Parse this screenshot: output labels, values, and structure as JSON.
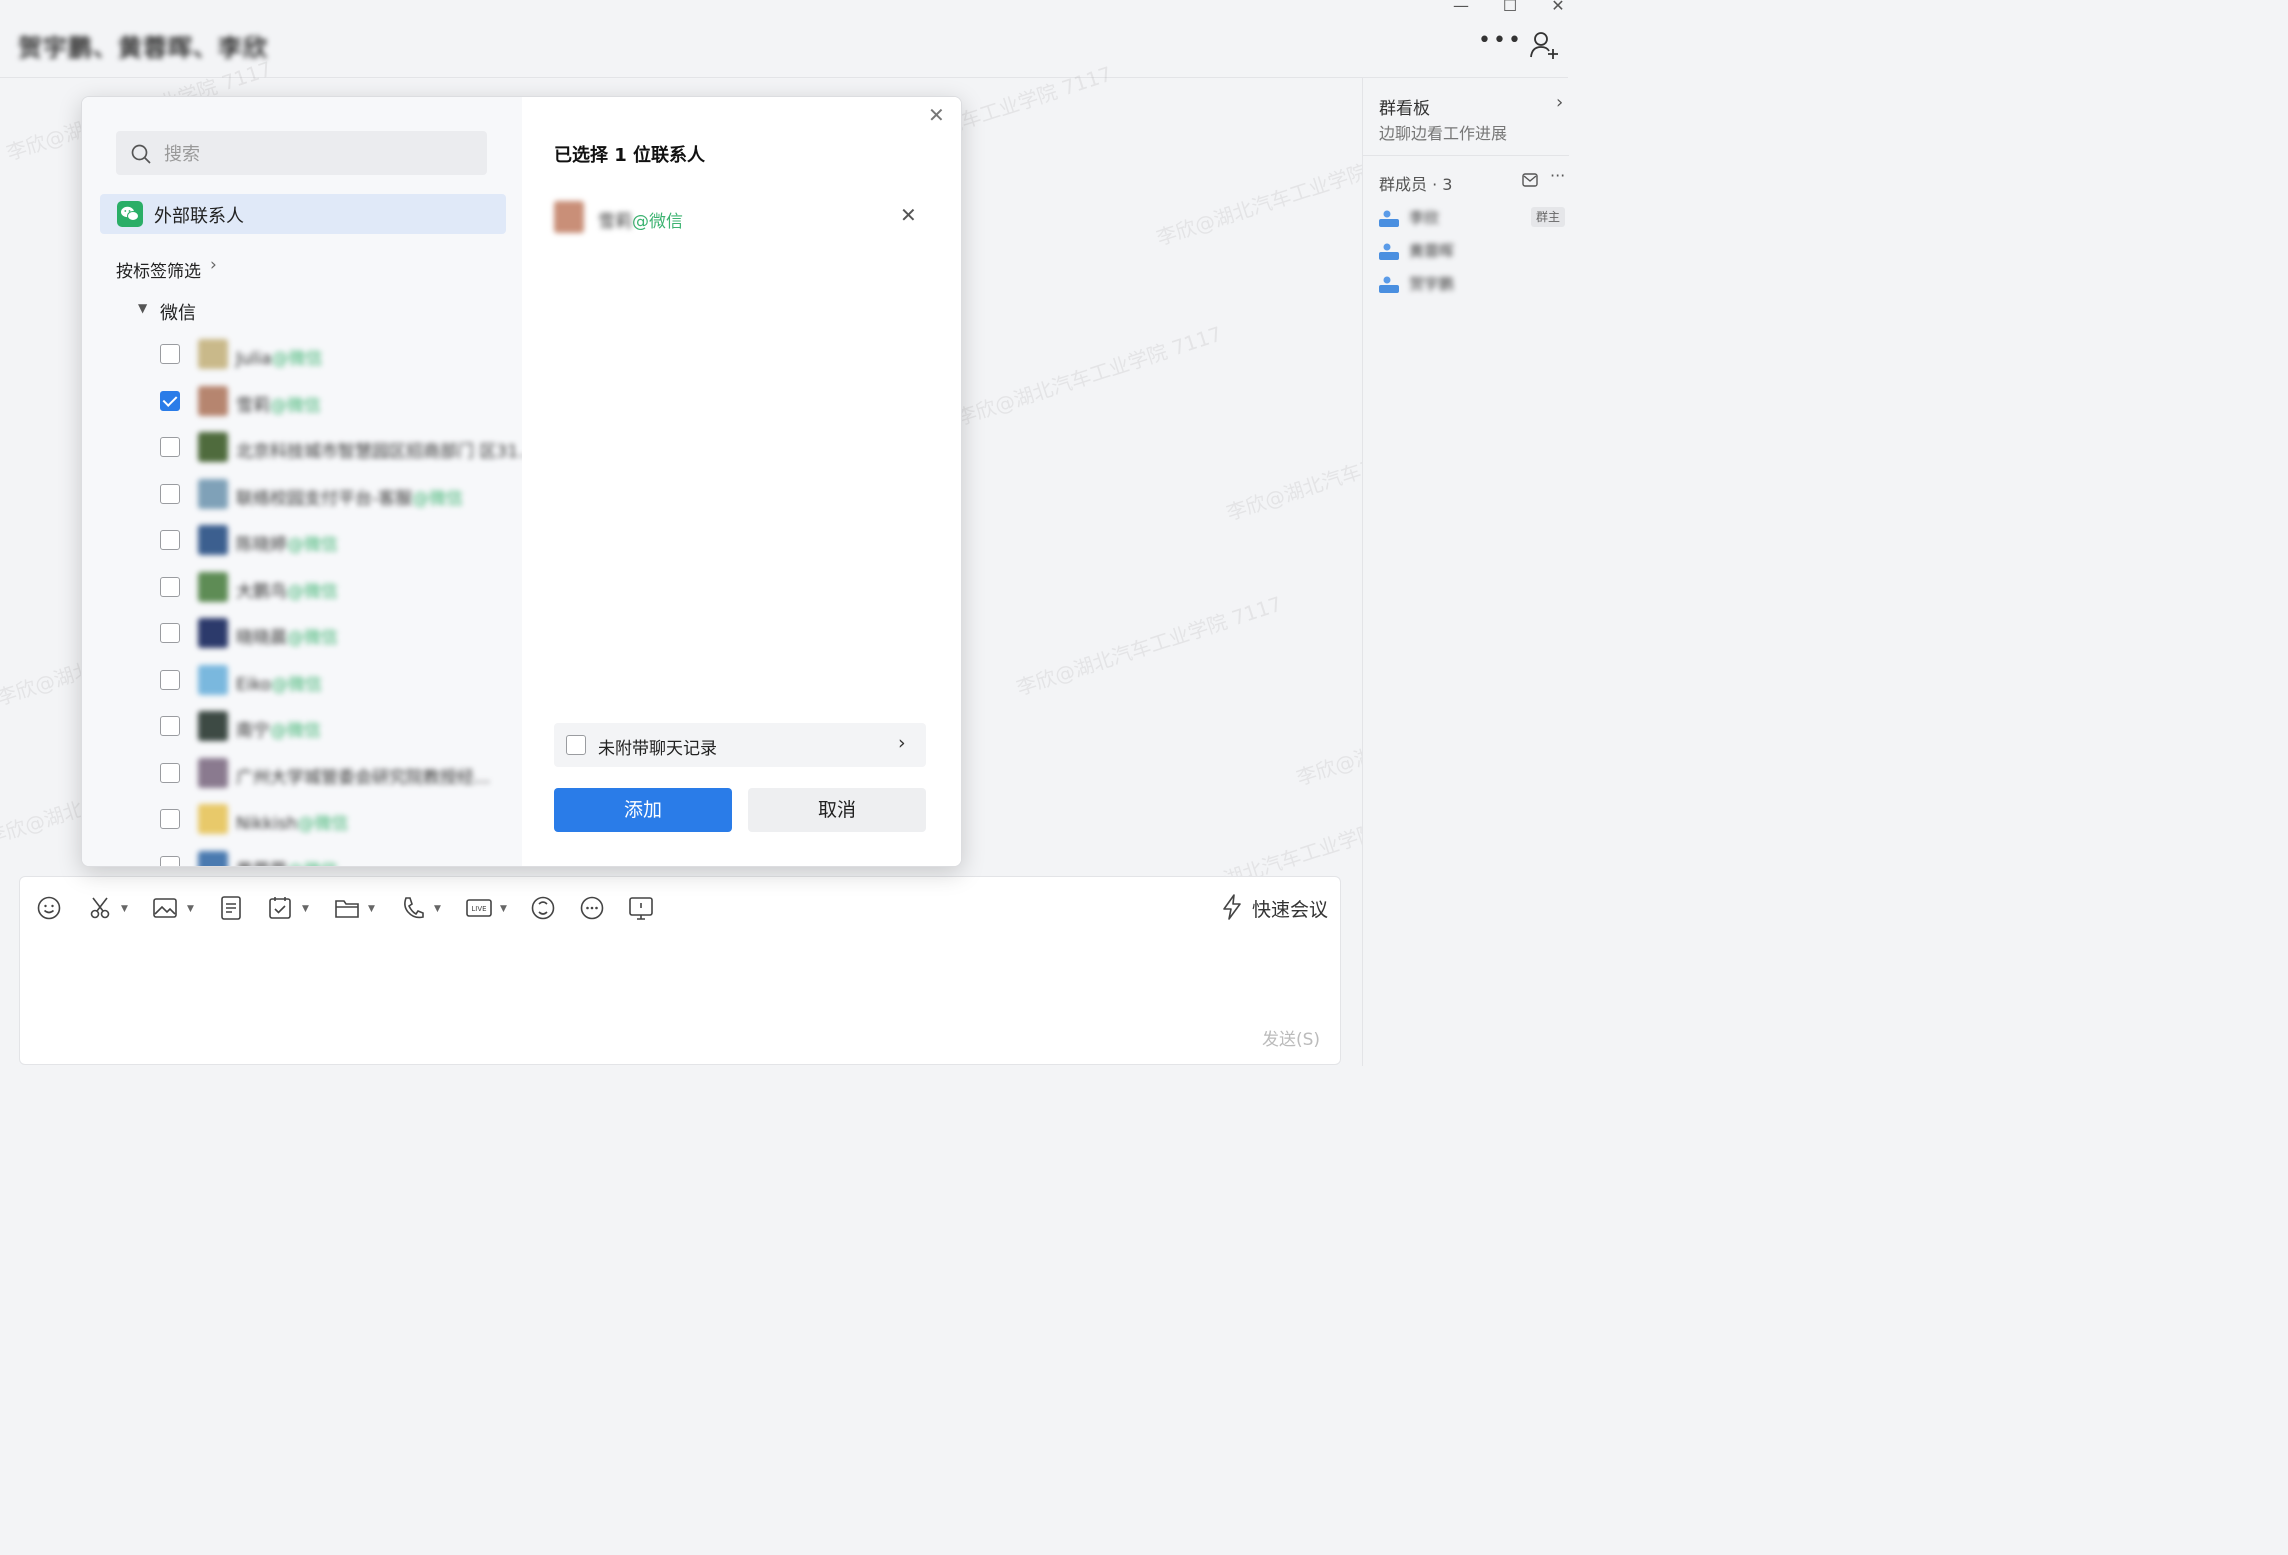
{
  "window": {
    "title": "贺宇鹏、黄蓉晖、李欣",
    "minimize_icon": "minimize-icon",
    "maximize_icon": "maximize-icon",
    "close_icon": "close-icon",
    "more_icon": "more-icon",
    "add_member_icon": "add-member-icon"
  },
  "right_panel": {
    "board_title": "群看板",
    "board_subtitle": "边聊边看工作进展",
    "members_label": "群成员 · 3",
    "owner_badge": "群主",
    "members": [
      {
        "name": "李欣"
      },
      {
        "name": "黄蓉晖"
      },
      {
        "name": "贺宇鹏"
      }
    ]
  },
  "dialog": {
    "search_placeholder": "搜索",
    "external_contacts_label": "外部联系人",
    "tag_filter_label": "按标签筛选",
    "wechat_group_label": "微信",
    "contacts": [
      {
        "name": "Julia",
        "tag": "@微信",
        "checked": false,
        "avatar_color": "#c9b98a"
      },
      {
        "name": "雪莉",
        "tag": "@微信",
        "checked": true,
        "avatar_color": "#b6856f"
      },
      {
        "name": "北京科技城市智慧园区招商部门 区31...",
        "tag": "",
        "checked": false,
        "avatar_color": "#4f6b3d"
      },
      {
        "name": "联络校园支付平台-客服",
        "tag": "@微信",
        "checked": false,
        "avatar_color": "#7fa1b8"
      },
      {
        "name": "陈晓婷",
        "tag": "@微信",
        "checked": false,
        "avatar_color": "#3c5f8f"
      },
      {
        "name": "大鹏鸟",
        "tag": "@微信",
        "checked": false,
        "avatar_color": "#5e8c55"
      },
      {
        "name": "晓晓晨",
        "tag": "@微信",
        "checked": false,
        "avatar_color": "#2c3a6b"
      },
      {
        "name": "Eiko",
        "tag": "@微信",
        "checked": false,
        "avatar_color": "#7ab8de"
      },
      {
        "name": "南宁",
        "tag": "@微信",
        "checked": false,
        "avatar_color": "#3d4a44"
      },
      {
        "name": "广州大学城管委会研究院教授经...",
        "tag": "",
        "checked": false,
        "avatar_color": "#8a7a8f"
      },
      {
        "name": "Nikkish",
        "tag": "@微信",
        "checked": false,
        "avatar_color": "#e8c96a"
      },
      {
        "name": "黄蓉蓉",
        "tag": "@微信",
        "checked": false,
        "avatar_color": "#4a7ab0"
      }
    ],
    "selected_title": "已选择 1 位联系人",
    "selected": [
      {
        "name": "雪莉",
        "tag": "@微信"
      }
    ],
    "history_label": "未附带聊天记录",
    "add_label": "添加",
    "cancel_label": "取消"
  },
  "input_toolbar": {
    "icons": [
      "emoji-icon",
      "scissors-icon",
      "image-icon",
      "document-icon",
      "calendar-check-icon",
      "folder-icon",
      "phone-icon",
      "live-icon",
      "chatgpt-like-icon",
      "more-circle-icon",
      "screen-share-icon"
    ],
    "quick_meeting_label": "快速会议",
    "send_label": "发送(S)"
  },
  "watermark": "李欣@湖北汽车工业学院 7117"
}
